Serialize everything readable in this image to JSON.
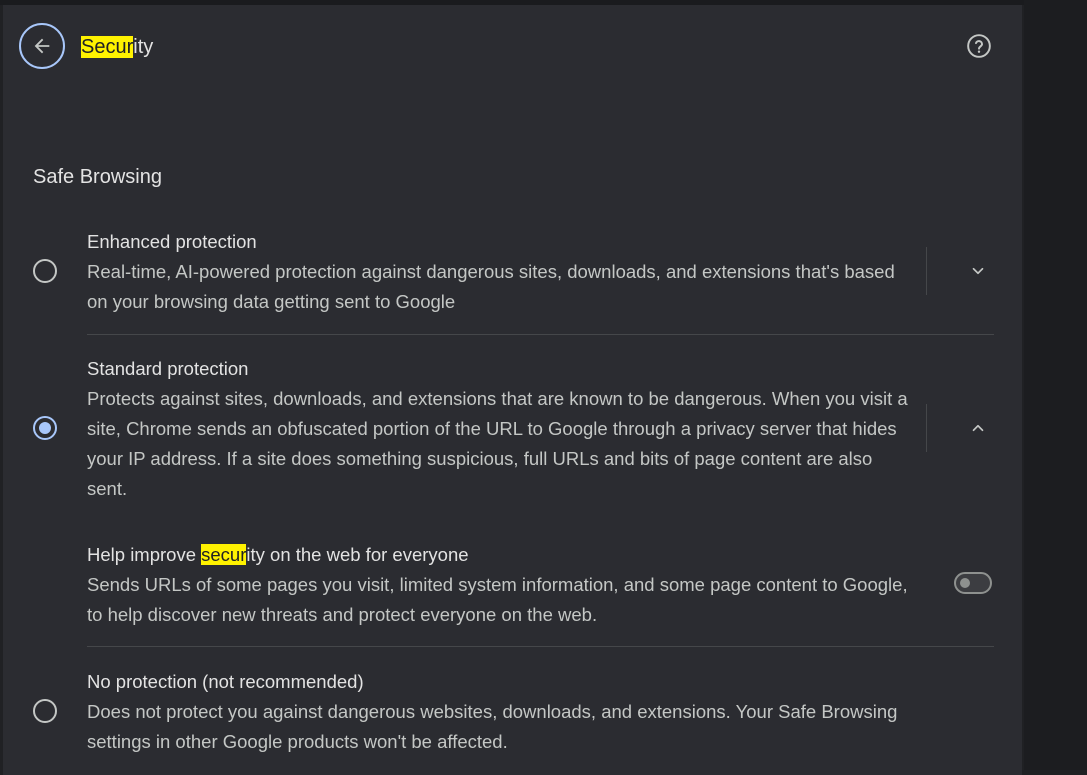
{
  "header": {
    "title_highlight": "Secur",
    "title_rest": "ity",
    "back_icon": "arrow-left-icon",
    "help_icon": "help-circle-icon"
  },
  "safe_browsing": {
    "section_title": "Safe Browsing",
    "enhanced": {
      "title": "Enhanced protection",
      "description": "Real-time, AI-powered protection against dangerous sites, downloads, and extensions that's based on your browsing data getting sent to Google",
      "selected": false,
      "expand_icon": "chevron-down-icon"
    },
    "standard": {
      "title": "Standard protection",
      "description": "Protects against sites, downloads, and extensions that are known to be dangerous. When you visit a site, Chrome sends an obfuscated portion of the URL to Google through a privacy server that hides your IP address. If a site does something suspicious, full URLs and bits of page content are also sent.",
      "selected": true,
      "expand_icon": "chevron-up-icon"
    },
    "help_improve": {
      "title_before": "Help improve ",
      "title_highlight": "secur",
      "title_after": "ity on the web for everyone",
      "description": "Sends URLs of some pages you visit, limited system information, and some page content to Google, to help discover new threats and protect everyone on the web.",
      "enabled": false
    },
    "none": {
      "title": "No protection (not recommended)",
      "description": "Does not protect you against dangerous websites, downloads, and extensions. Your Safe Browsing settings in other Google products won't be affected.",
      "selected": false
    }
  },
  "colors": {
    "accent": "#a8c7fa",
    "highlight": "#fff200",
    "background": "#2b2c31"
  }
}
